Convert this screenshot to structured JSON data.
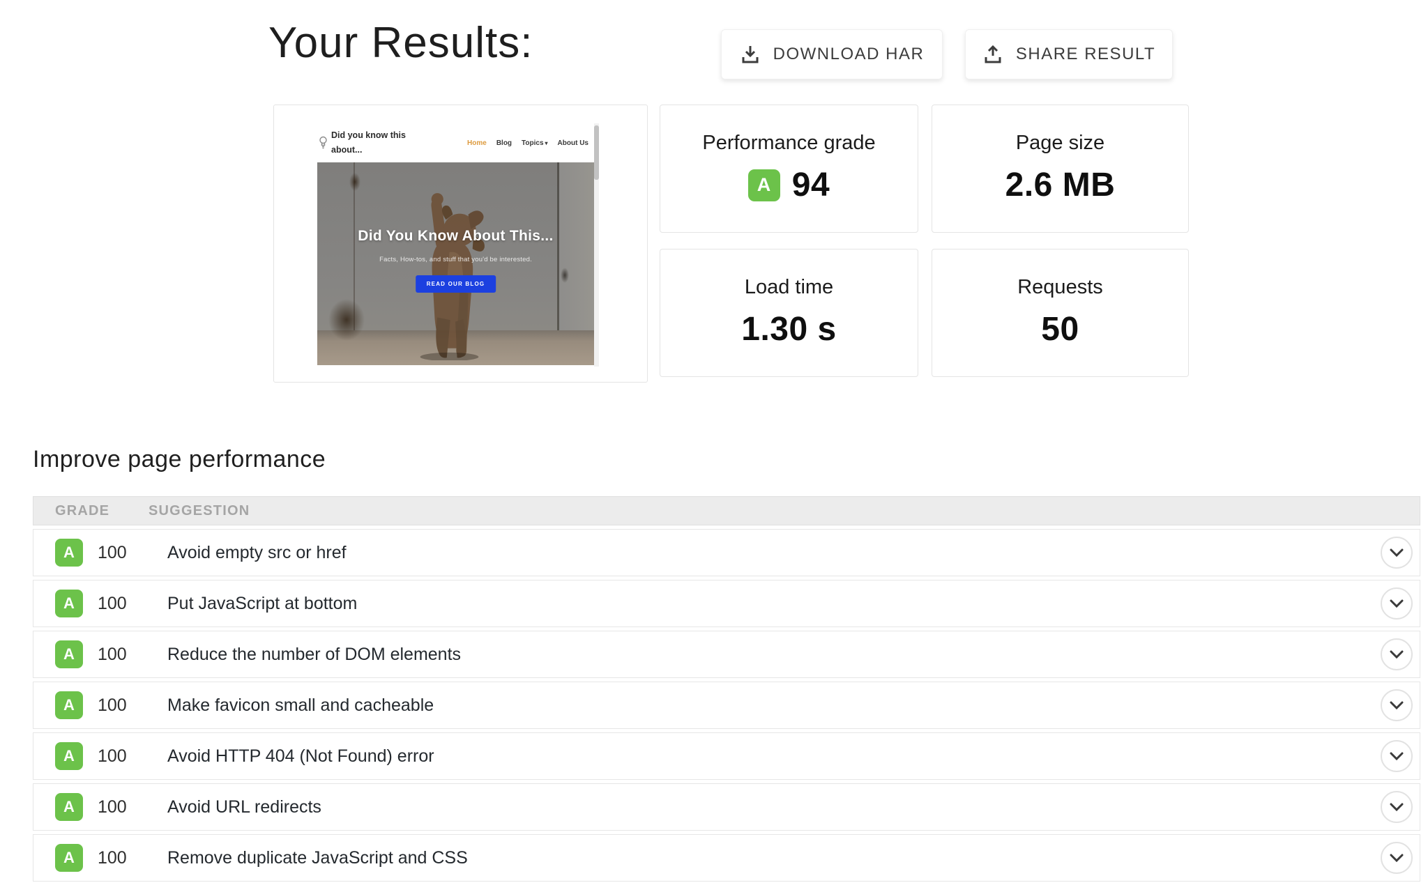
{
  "header": {
    "title": "Your Results:",
    "download_har_label": "DOWNLOAD HAR",
    "share_result_label": "SHARE RESULT"
  },
  "thumbnail_site": {
    "logo_line1": "Did you know this",
    "logo_line2": "about...",
    "nav": [
      "Home",
      "Blog",
      "Topics",
      "About Us"
    ],
    "hero_title": "Did You Know About This...",
    "hero_subtitle": "Facts, How-tos, and stuff that you'd be interested.",
    "hero_button": "READ OUR BLOG"
  },
  "metrics": [
    {
      "label": "Performance grade",
      "grade": "A",
      "value": "94"
    },
    {
      "label": "Page size",
      "value": "2.6 MB"
    },
    {
      "label": "Load time",
      "value": "1.30 s"
    },
    {
      "label": "Requests",
      "value": "50"
    }
  ],
  "improve": {
    "heading": "Improve page performance",
    "columns": {
      "grade": "GRADE",
      "suggestion": "SUGGESTION"
    },
    "rows": [
      {
        "grade": "A",
        "score": "100",
        "suggestion": "Avoid empty src or href"
      },
      {
        "grade": "A",
        "score": "100",
        "suggestion": "Put JavaScript at bottom"
      },
      {
        "grade": "A",
        "score": "100",
        "suggestion": "Reduce the number of DOM elements"
      },
      {
        "grade": "A",
        "score": "100",
        "suggestion": "Make favicon small and cacheable"
      },
      {
        "grade": "A",
        "score": "100",
        "suggestion": "Avoid HTTP 404 (Not Found) error"
      },
      {
        "grade": "A",
        "score": "100",
        "suggestion": "Avoid URL redirects"
      },
      {
        "grade": "A",
        "score": "100",
        "suggestion": "Remove duplicate JavaScript and CSS"
      }
    ]
  },
  "icons": {
    "download_har": "download-tray-arrow-down",
    "share_result": "share-tray-arrow-up",
    "row_expand": "chevron-down",
    "site_logo": "lightbulb",
    "topics_caret": "caret-down"
  },
  "colors": {
    "grade_green": "#6cc24a",
    "hero_button_blue": "#1c40e0",
    "nav_active_orange": "#dd9b3f"
  }
}
